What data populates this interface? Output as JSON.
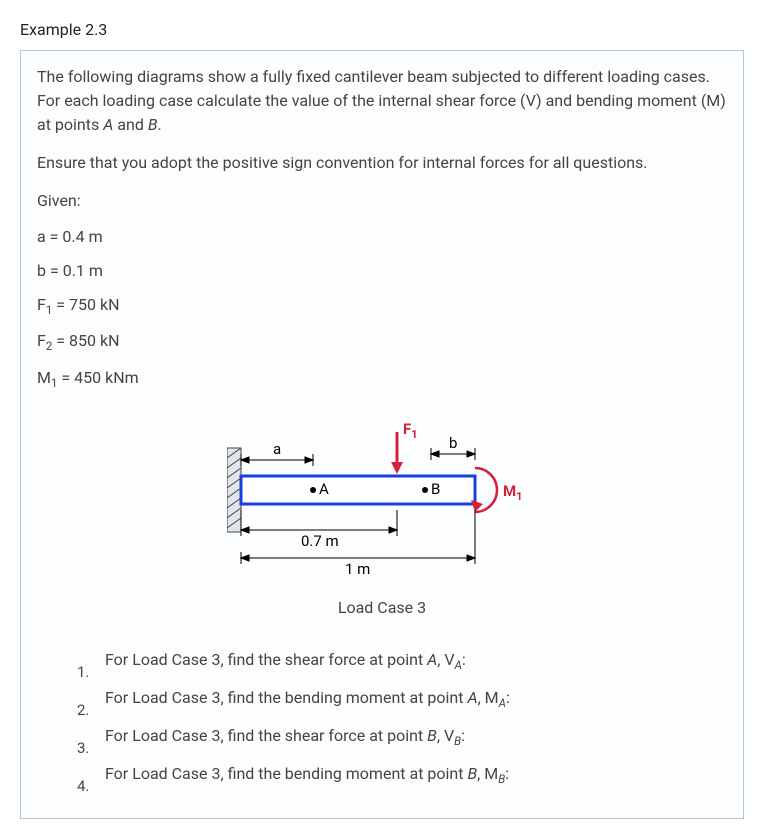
{
  "title": "Example 2.3",
  "intro_p1_a": "The following diagrams show a fully fixed cantilever beam subjected to different loading cases. For each loading case calculate the value of the internal shear force (V) and bending moment (M) at points ",
  "intro_p1_pointA": "A",
  "intro_p1_and": " and ",
  "intro_p1_pointB": "B",
  "intro_p1_end": ".",
  "intro_p2": "Ensure that you adopt the positive sign convention for internal forces for all questions.",
  "given_label": "Given:",
  "given": {
    "a": "a = 0.4 m",
    "b": "b = 0.1 m",
    "F1_pre": "F",
    "F1_sub": "1",
    "F1_post": " = 750 kN",
    "F2_pre": "F",
    "F2_sub": "2",
    "F2_post": " = 850 kN",
    "M1_pre": "M",
    "M1_sub": "1",
    "M1_post": " = 450 kNm"
  },
  "diagram": {
    "label_a": "a",
    "label_b": "b",
    "label_F1": "F",
    "label_F1_sub": "1",
    "label_M1": "M",
    "label_M1_sub": "1",
    "point_A": "A",
    "point_B": "B",
    "dim_07": "0.7 m",
    "dim_1": "1 m",
    "caption": "Load Case 3"
  },
  "questions": [
    {
      "num": "1.",
      "pre": "For Load Case 3, find the shear force at point ",
      "pt": "A",
      "mid": ", V",
      "sub": "A",
      "post": ":"
    },
    {
      "num": "2.",
      "pre": "For Load Case 3, find the bending moment at point ",
      "pt": "A",
      "mid": ", M",
      "sub": "A",
      "post": ":"
    },
    {
      "num": "3.",
      "pre": "For Load Case 3, find the shear force at point ",
      "pt": "B",
      "mid": ", V",
      "sub": "B",
      "post": ":"
    },
    {
      "num": "4.",
      "pre": "For Load Case 3, find the bending moment at point ",
      "pt": "B",
      "mid": ", M",
      "sub": "B",
      "post": ":"
    }
  ]
}
